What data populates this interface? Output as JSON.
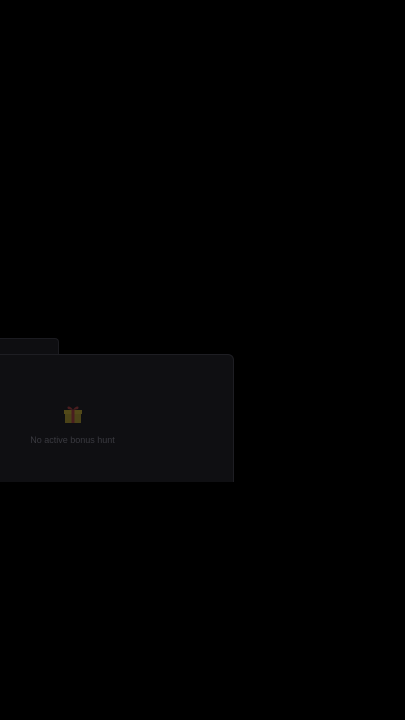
{
  "bonus_hunt": {
    "empty_message": "No active bonus hunt",
    "empty_icon": "gift-icon"
  },
  "colors": {
    "background": "#000000",
    "panel": "#0f0f12",
    "gift_box": "#8a7a20",
    "gift_ribbon": "#7a2a2a"
  }
}
